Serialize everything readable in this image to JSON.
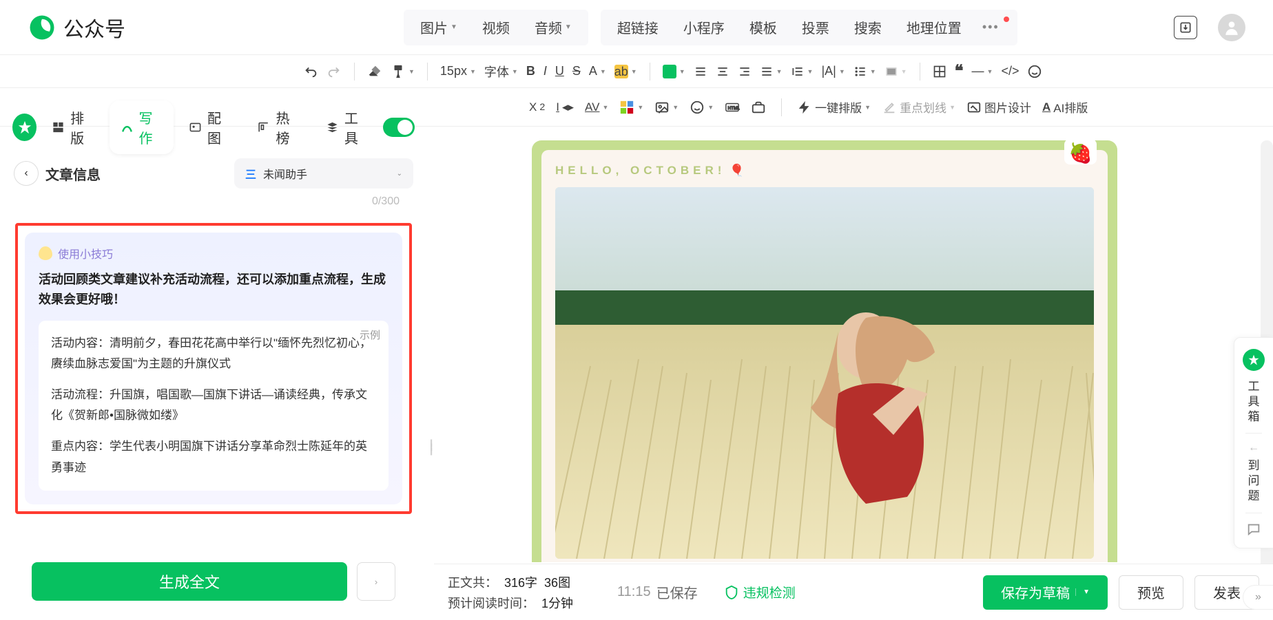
{
  "brand": "公众号",
  "top": {
    "group1": [
      {
        "label": "图片",
        "caret": true
      },
      {
        "label": "视频",
        "caret": false
      },
      {
        "label": "音频",
        "caret": true
      }
    ],
    "group2": [
      {
        "label": "超链接"
      },
      {
        "label": "小程序"
      },
      {
        "label": "模板"
      },
      {
        "label": "投票"
      },
      {
        "label": "搜索"
      },
      {
        "label": "地理位置"
      }
    ]
  },
  "ribbon": {
    "fontsize": "15px",
    "fontfamily": "字体",
    "auto_layout": "一键排版",
    "strike": "重点划线",
    "image_design": "图片设计",
    "ai_layout": "AI排版"
  },
  "side_tabs": [
    {
      "label": "排版",
      "active": false
    },
    {
      "label": "写作",
      "active": true
    },
    {
      "label": "配图",
      "active": false
    },
    {
      "label": "热榜",
      "active": false
    },
    {
      "label": "工具",
      "active": false
    }
  ],
  "side_sub": {
    "title": "文章信息",
    "assistant": "未闻助手",
    "counter": "0/300"
  },
  "tip": {
    "badge": "使用小技巧",
    "headline": "活动回顾类文章建议补充活动流程，还可以添加重点流程，生成效果会更好哦！",
    "example_label": "示例",
    "p1": "活动内容：清明前夕，春田花花高中举行以\"缅怀先烈忆初心，赓续血脉志爱国\"为主题的升旗仪式",
    "p2": "活动流程：升国旗，唱国歌—国旗下讲话—诵读经典，传承文化《贺新郎•国脉微如缕》",
    "p3": "重点内容：学生代表小明国旗下讲话分享革命烈士陈延年的英勇事迹"
  },
  "generate_btn": "生成全文",
  "canvas": {
    "hello": "HELLO, OCTOBER!"
  },
  "status": {
    "text_prefix": "正文共：",
    "word_count": "316字",
    "img_count": "36图",
    "read_prefix": "预计阅读时间：",
    "read_time": "1分钟",
    "time": "11:15",
    "saved": "已保存",
    "violation": "违规检测",
    "save_draft": "保存为草稿",
    "preview": "预览",
    "publish": "发表"
  },
  "dock": {
    "top": "工具箱",
    "bottom": "到问题"
  }
}
